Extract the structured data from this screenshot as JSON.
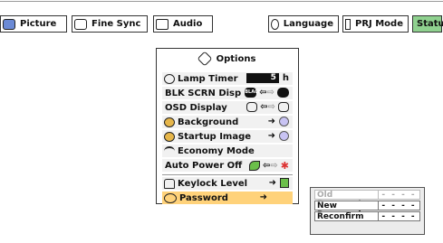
{
  "tabs": {
    "picture": "Picture",
    "fine_sync": "Fine Sync",
    "audio": "Audio",
    "language": "Language",
    "prj_mode": "PRJ Mode",
    "status": "Status"
  },
  "options_menu": {
    "title": "Options",
    "items": [
      {
        "label": "Lamp Timer",
        "value": "5",
        "unit": "h"
      },
      {
        "label": "BLK SCRN Disp",
        "icon_text": "BLACK"
      },
      {
        "label": "OSD Display"
      },
      {
        "label": "Background"
      },
      {
        "label": "Startup Image"
      },
      {
        "label": "Economy Mode"
      },
      {
        "label": "Auto Power Off"
      },
      {
        "label": "Keylock Level"
      },
      {
        "label": "Password"
      }
    ]
  },
  "password_panel": {
    "rows": [
      {
        "label": "Old Password",
        "value": "- - - -",
        "enabled": false
      },
      {
        "label": "New Password",
        "value": "- - - -",
        "enabled": true
      },
      {
        "label": "Reconfirm",
        "value": "- - - -",
        "enabled": true
      }
    ]
  },
  "colors": {
    "status_tab": "#8fd18f",
    "selected_row": "#ffd27a",
    "lavender_button": "#c8c3f3"
  }
}
